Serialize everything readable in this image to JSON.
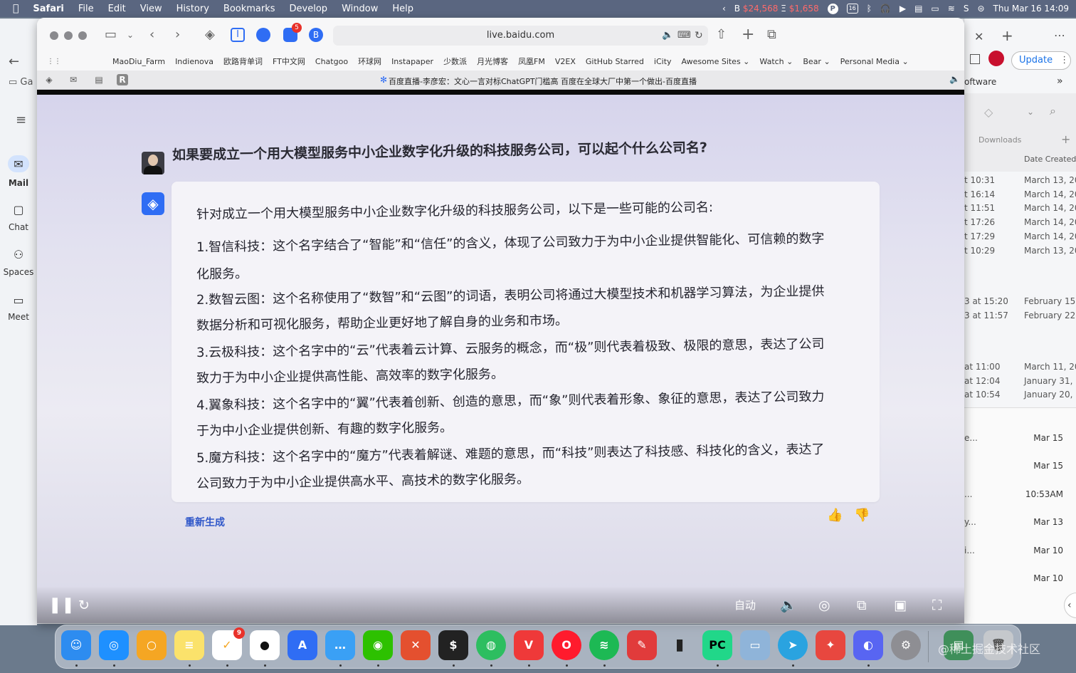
{
  "menubar": {
    "apple": "",
    "app_name": "Safari",
    "items": [
      "File",
      "Edit",
      "View",
      "History",
      "Bookmarks",
      "Develop",
      "Window",
      "Help"
    ],
    "ticker_prefix": "B",
    "ticker_a": "$24,568",
    "ticker_sep": "Ξ",
    "ticker_b": "$1,658",
    "calendar_day": "16",
    "datetime": "Thu Mar 16  14:09"
  },
  "browser": {
    "url": "live.baidu.com",
    "extension_badge": "5",
    "extension_b": "B",
    "bookmarks": [
      "MaoDiu_Farm",
      "Indienova",
      "欧路背单词",
      "FT中文网",
      "Chatgoo",
      "环球网",
      "Instapaper",
      "少数派",
      "月光博客",
      "凤凰FM",
      "V2EX",
      "GitHub Starred",
      "iCity",
      "Awesome Sites ⌄",
      "Watch ⌄",
      "Bear ⌄",
      "Personal Media ⌄"
    ],
    "tab_title": "百度直播-李彦宏：文心一言对标ChatGPT门槛高 百度在全球大厂中第一个做出-百度直播",
    "tab_icon_r": "R"
  },
  "video": {
    "question": "如果要成立一个用大模型服务中小企业数字化升级的科技服务公司，可以起个什么公司名?",
    "answer_lines": [
      "针对成立一个用大模型服务中小企业数字化升级的科技服务公司，以下是一些可能的公司名:",
      "1.智信科技：这个名字结合了“智能”和“信任”的含义，体现了公司致力于为中小企业提供智能化、可信赖的数字",
      "化服务。",
      "2.数智云图：这个名称使用了“数智”和“云图”的词语，表明公司将通过大模型技术和机器学习算法，为企业提供",
      "数据分析和可视化服务，帮助企业更好地了解自身的业务和市场。",
      "3.云极科技：这个名字中的“云”代表着云计算、云服务的概念，而“极”则代表着极致、极限的意思，表达了公司",
      "致力于为中小企业提供高性能、高效率的数字化服务。",
      "4.翼象科技：这个名字中的“翼”代表着创新、创造的意思，而“象”则代表着形象、象征的意思，表达了公司致力",
      "于为中小企业提供创新、有趣的数字化服务。",
      "5.魔方科技：这个名字中的“魔方”代表着解谜、难题的意思，而“科技”则表达了科技感、科技化的含义，表达了",
      "公司致力于为中小企业提供高水平、高技术的数字化服务。"
    ],
    "regenerate": "重新生成",
    "quality": "自动"
  },
  "left_panel": {
    "items": [
      {
        "label": "Mail"
      },
      {
        "label": "Chat"
      },
      {
        "label": "Spaces"
      },
      {
        "label": "Meet"
      }
    ],
    "folder_text": "Ga"
  },
  "right_panel": {
    "update_label": "Update",
    "software_text": "oftware",
    "downloads_label": "Downloads",
    "date_created_label": "Date Created",
    "rows_a": [
      {
        "time": "t 10:31",
        "date": "March 13, 20"
      },
      {
        "time": "t 16:14",
        "date": "March 14, 20"
      },
      {
        "time": "t 11:51",
        "date": "March 14, 20"
      },
      {
        "time": "t 17:26",
        "date": "March 14, 20"
      },
      {
        "time": "t 17:29",
        "date": "March 14, 20"
      },
      {
        "time": "t 10:29",
        "date": "March 13, 20"
      }
    ],
    "rows_b": [
      {
        "time": "3 at 15:20",
        "date": "February 15,"
      },
      {
        "time": "3 at 11:57",
        "date": "February 22,"
      }
    ],
    "rows_c": [
      {
        "time": "at 11:00",
        "date": "March 11, 20"
      },
      {
        "time": "at 12:04",
        "date": "January 31, 2"
      },
      {
        "time": "at 10:54",
        "date": "January 20, 2"
      }
    ],
    "rows_d": [
      {
        "left": "e...",
        "right": "Mar 15"
      },
      {
        "left": "",
        "right": "Mar 15"
      },
      {
        "left": "...",
        "right": "10:53AM"
      },
      {
        "left": "y...",
        "right": "Mar 13"
      },
      {
        "left": "i...",
        "right": "Mar 10"
      },
      {
        "left": "",
        "right": "Mar 10"
      }
    ]
  },
  "dock": {
    "reminders_badge": "9",
    "watermark": "@稀土掘金技术社区",
    "pc_label": "PC",
    "appstore_label": "A"
  }
}
